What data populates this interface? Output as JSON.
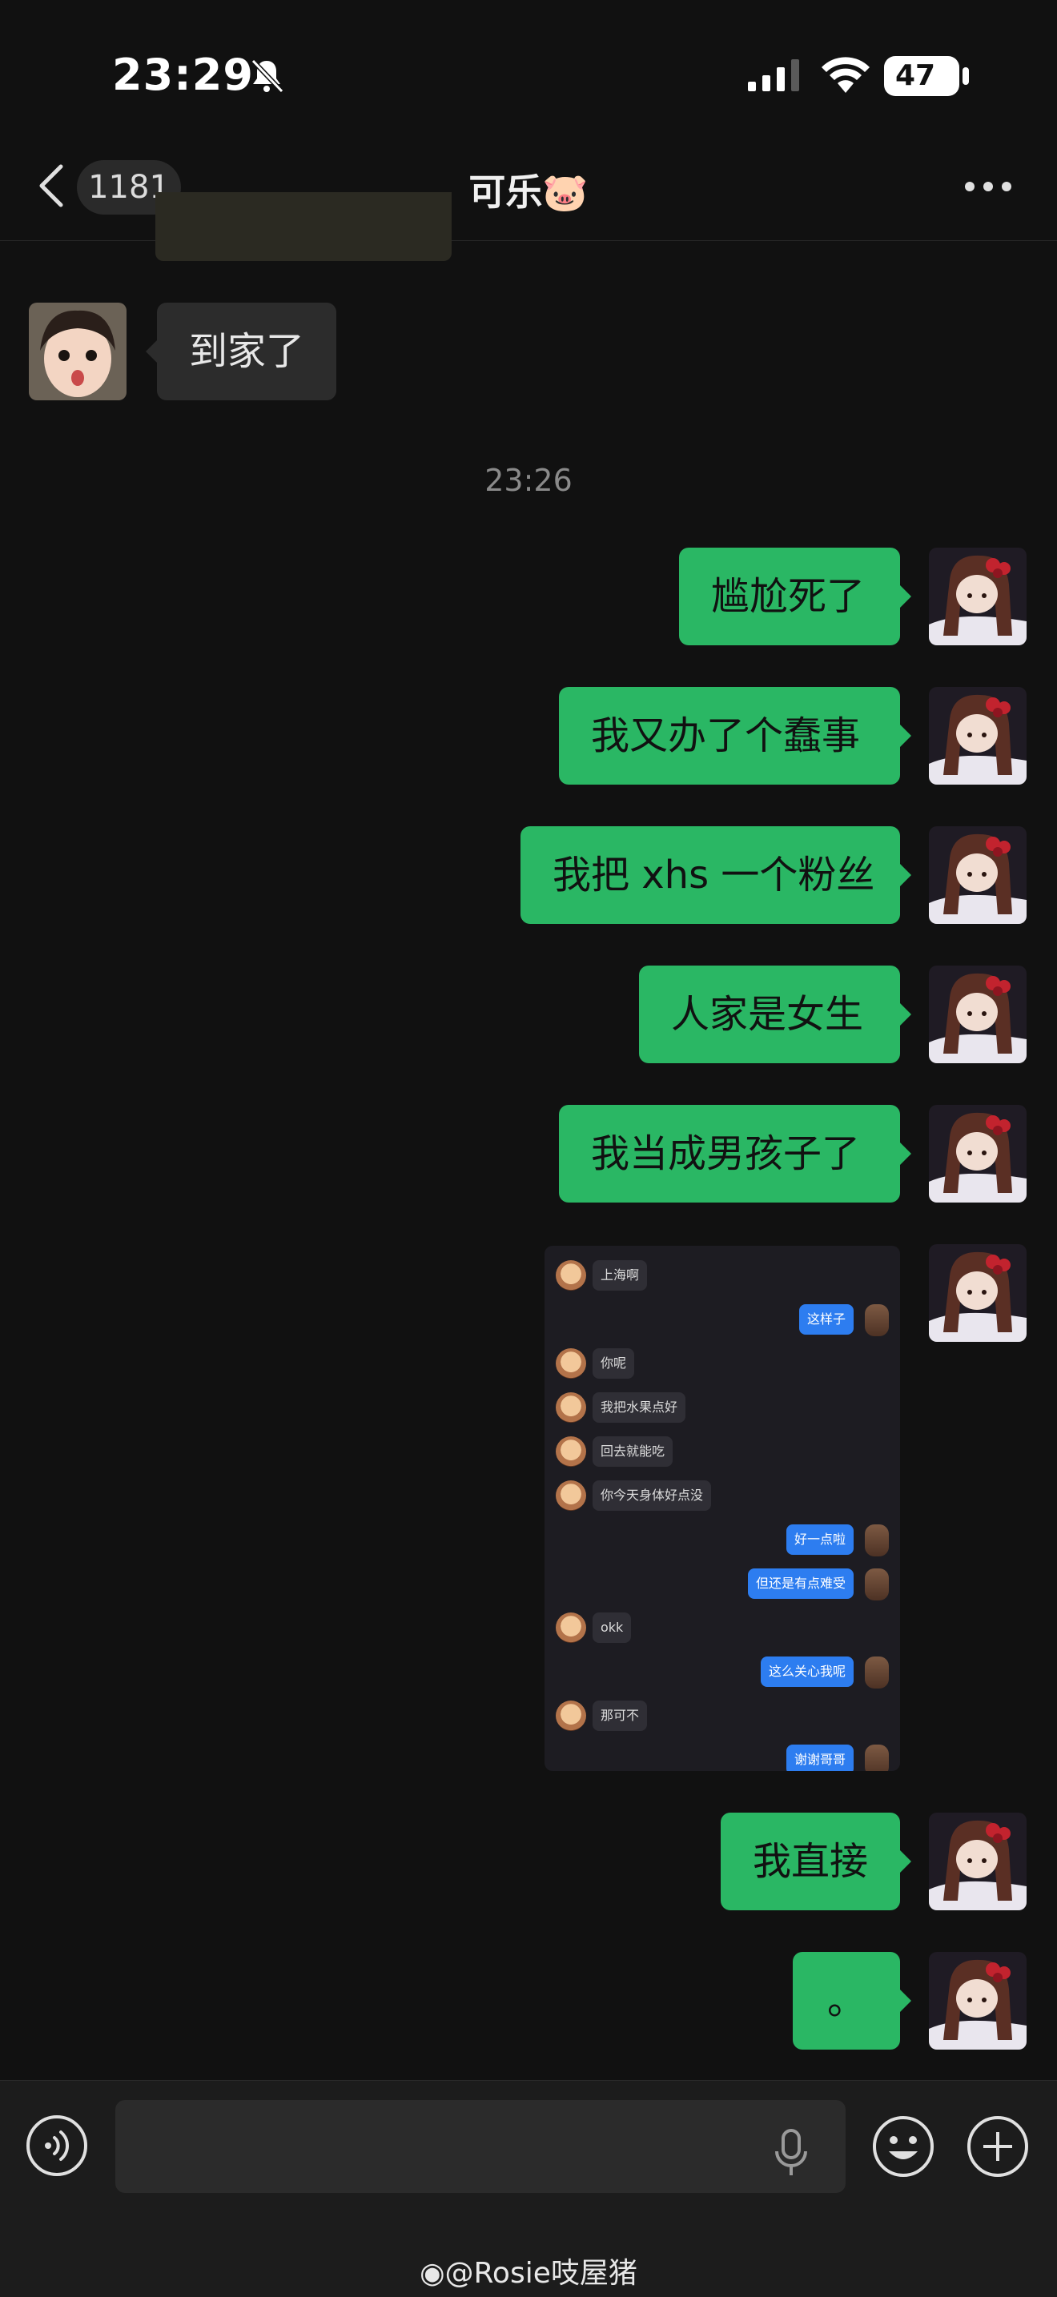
{
  "status_bar": {
    "time": "23:29",
    "battery": "47"
  },
  "header": {
    "unread_count": "1181",
    "title": "可乐🐷"
  },
  "messages_in": [
    {
      "text": "到家了"
    }
  ],
  "timestamp": "23:26",
  "messages_out": [
    {
      "text": "尴尬死了"
    },
    {
      "text": "我又办了个蠢事"
    },
    {
      "text": "我把 xhs 一个粉丝"
    },
    {
      "text": "人家是女生"
    },
    {
      "text": "我当成男孩子了"
    },
    {
      "text": "我直接"
    },
    {
      "text": "。"
    }
  ],
  "embedded_chat": [
    {
      "side": "left",
      "text": "上海啊"
    },
    {
      "side": "right",
      "text": "这样子"
    },
    {
      "side": "left",
      "text": "你呢"
    },
    {
      "side": "left",
      "text": "我把水果点好"
    },
    {
      "side": "left",
      "text": "回去就能吃"
    },
    {
      "side": "left",
      "text": "你今天身体好点没"
    },
    {
      "side": "right",
      "text": "好一点啦"
    },
    {
      "side": "right",
      "text": "但还是有点难受"
    },
    {
      "side": "left",
      "text": "okk"
    },
    {
      "side": "right",
      "text": "这么关心我呢"
    },
    {
      "side": "left",
      "text": "那可不"
    },
    {
      "side": "right",
      "text": "谢谢哥哥"
    }
  ],
  "watermark": "@Rosie吱屋猪",
  "colors": {
    "outgoing_bubble": "#2ab764",
    "incoming_bubble": "#2c2c2c",
    "embedded_out_bubble": "#2d7df0"
  }
}
